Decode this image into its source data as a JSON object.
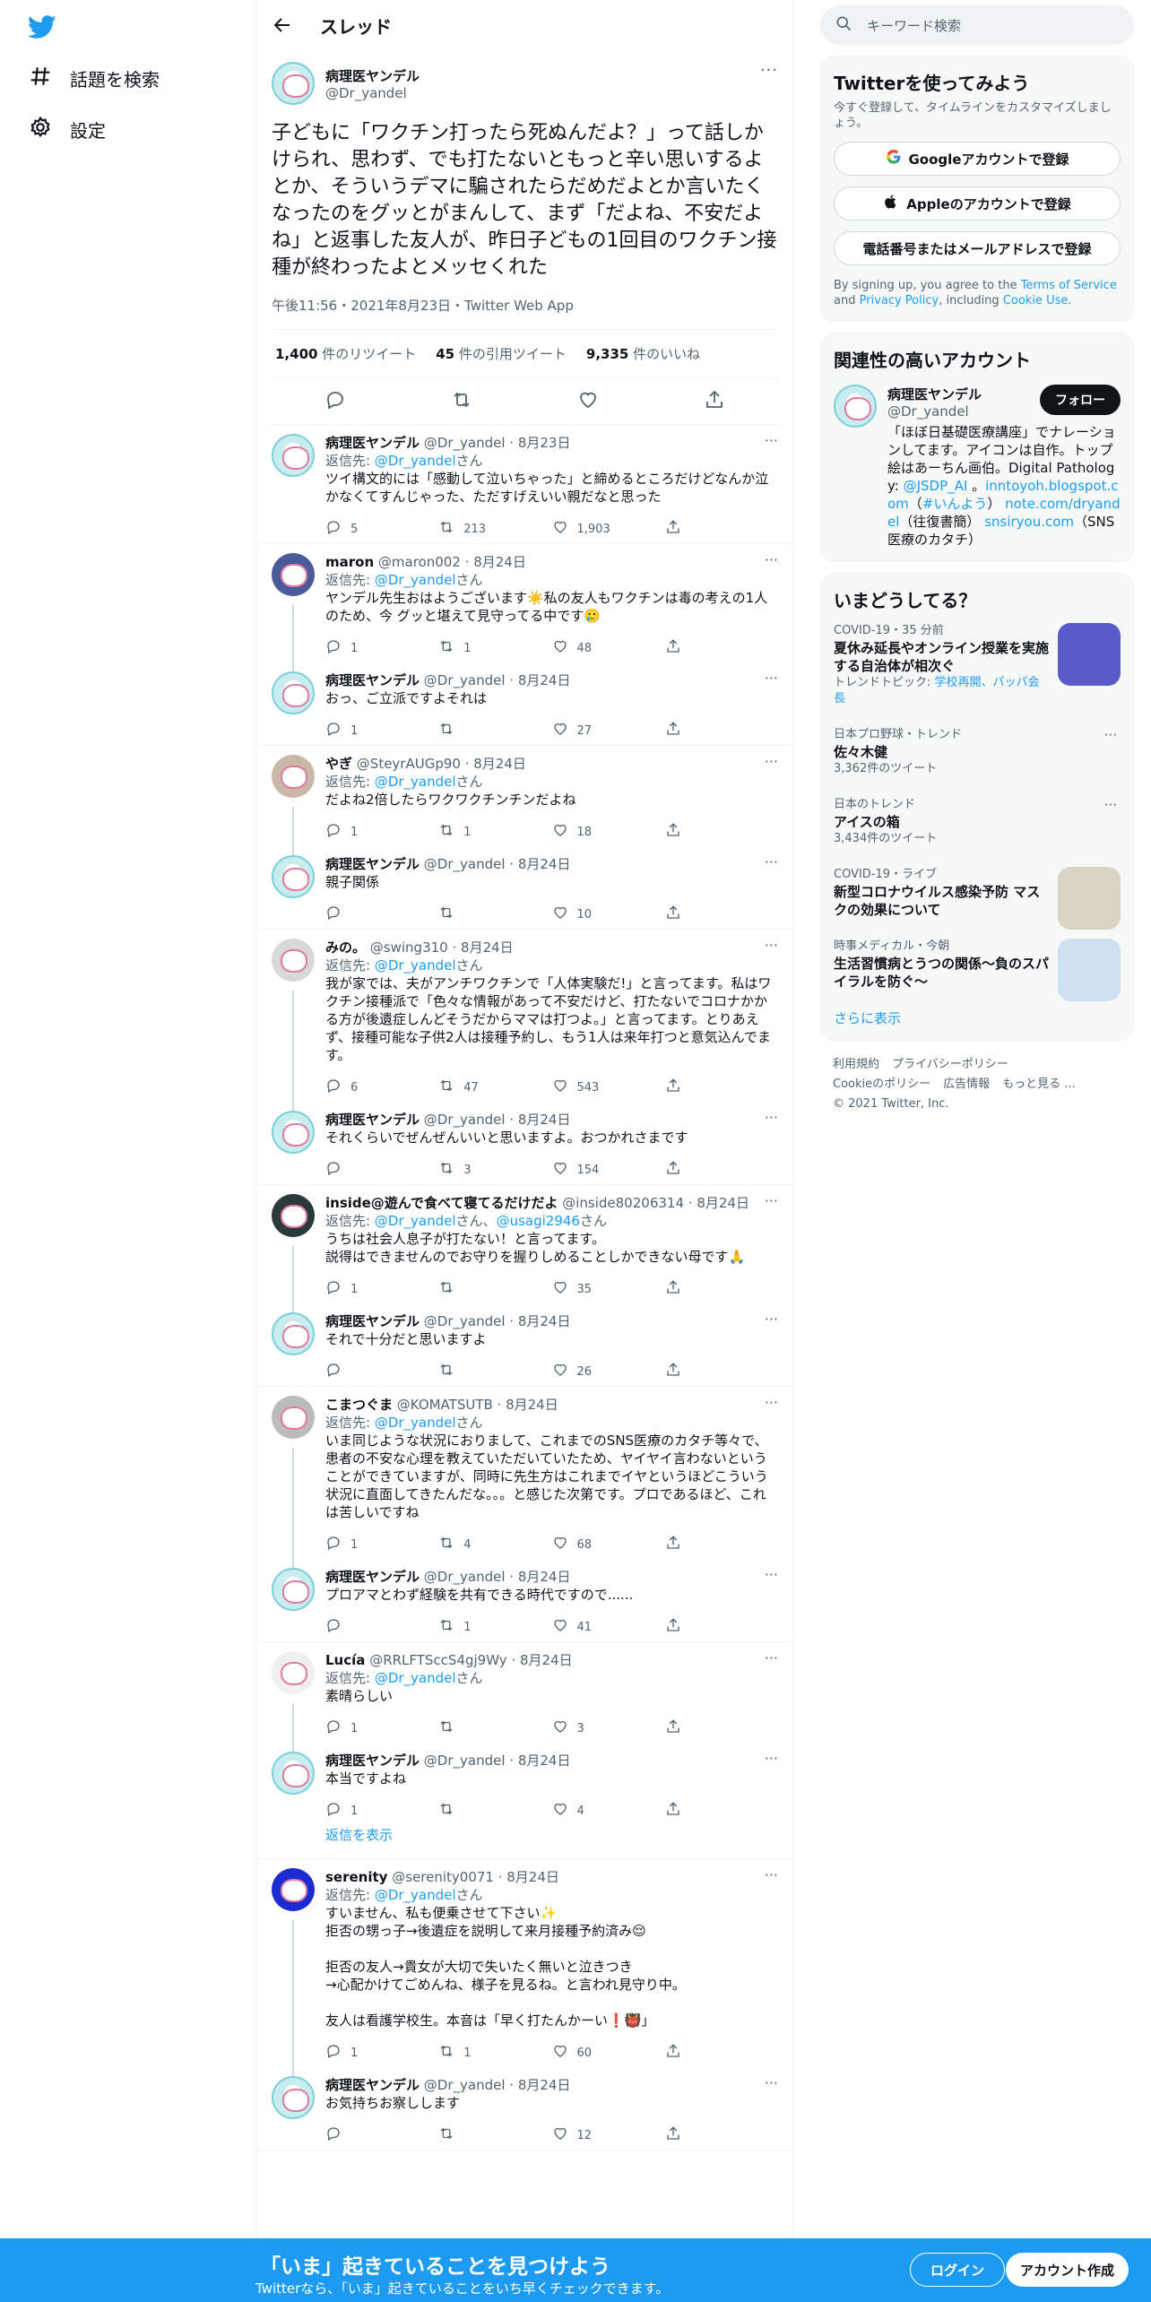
{
  "nav": {
    "explore": "話題を検索",
    "settings": "設定"
  },
  "header": {
    "title": "スレッド"
  },
  "focus": {
    "name": "病理医ヤンデル",
    "handle": "@Dr_yandel",
    "text": "子どもに「ワクチン打ったら死ぬんだよ？」って話しかけられ、思わず、でも打たないともっと辛い思いするよとか、そういうデマに騙されたらだめだよとか言いたくなったのをグッとがまんして、まず「だよね、不安だよね」と返事した友人が、昨日子どもの1回目のワクチン接種が終わったよとメッセくれた",
    "meta": "午後11:56・2021年8月23日・Twitter Web App",
    "retweets_n": "1,400",
    "retweets_l": "件のリツイート",
    "quotes_n": "45",
    "quotes_l": "件の引用ツイート",
    "likes_n": "9,335",
    "likes_l": "件のいいね"
  },
  "reply_prefix": "返信先: ",
  "san": "さん",
  "tweets": [
    {
      "name": "病理医ヤンデル",
      "handle": "@Dr_yandel",
      "date": "8月23日",
      "reply_to": "@Dr_yandel",
      "text": "ツイ構文的には「感動して泣いちゃった」と締めるところだけどなんか泣かなくてすんじゃった、ただすげえいい親だなと思った",
      "replies": "5",
      "rts": "213",
      "likes": "1,903"
    },
    {
      "name": "maron",
      "handle": "@maron002",
      "date": "8月24日",
      "reply_to": "@Dr_yandel",
      "text": "ヤンデル先生おはようございます☀️私の友人もワクチンは毒の考えの1人のため、今 グッと堪えて見守ってる中です🥲",
      "replies": "1",
      "rts": "1",
      "likes": "48"
    },
    {
      "name": "病理医ヤンデル",
      "handle": "@Dr_yandel",
      "date": "8月24日",
      "reply_to": "",
      "text": "おっ、ご立派ですよそれは",
      "replies": "1",
      "rts": "",
      "likes": "27"
    },
    {
      "name": "やぎ",
      "handle": "@SteyrAUGp90",
      "date": "8月24日",
      "reply_to": "@Dr_yandel",
      "text": "だよね2倍したらワクワクチンチンだよね",
      "replies": "1",
      "rts": "1",
      "likes": "18"
    },
    {
      "name": "病理医ヤンデル",
      "handle": "@Dr_yandel",
      "date": "8月24日",
      "reply_to": "",
      "text": "親子関係",
      "replies": "",
      "rts": "",
      "likes": "10"
    },
    {
      "name": "みの。",
      "handle": "@swing310",
      "date": "8月24日",
      "reply_to": "@Dr_yandel",
      "text": "我が家では、夫がアンチワクチンで「人体実験だ!」と言ってます。私はワクチン接種派で「色々な情報があって不安だけど、打たないでコロナかかる方が後遺症しんどそうだからママは打つよ。」と言ってます。とりあえず、接種可能な子供2人は接種予約し、もう1人は来年打つと意気込んでます。",
      "replies": "6",
      "rts": "47",
      "likes": "543"
    },
    {
      "name": "病理医ヤンデル",
      "handle": "@Dr_yandel",
      "date": "8月24日",
      "reply_to": "",
      "text": "それくらいでぜんぜんいいと思いますよ。おつかれさまです",
      "replies": "",
      "rts": "3",
      "likes": "154"
    },
    {
      "name": "inside@遊んで食べて寝てるだけだよ",
      "handle": "@inside80206314",
      "date": "8月24日",
      "reply_to": "@Dr_yandel",
      "reply_to2": "@usagi2946",
      "text": "うちは社会人息子が打たない！と言ってます。\n説得はできませんのでお守りを握りしめることしかできない母です🙏",
      "replies": "1",
      "rts": "",
      "likes": "35"
    },
    {
      "name": "病理医ヤンデル",
      "handle": "@Dr_yandel",
      "date": "8月24日",
      "reply_to": "",
      "text": "それで十分だと思いますよ",
      "replies": "",
      "rts": "",
      "likes": "26"
    },
    {
      "name": "こまつぐま",
      "handle": "@KOMATSUTB",
      "date": "8月24日",
      "reply_to": "@Dr_yandel",
      "text": "いま同じような状況におりまして、これまでのSNS医療のカタチ等々で、患者の不安な心理を教えていただいていたため、ヤイヤイ言わないということができていますが、同時に先生方はこれまでイヤというほどこういう状況に直面してきたんだな。。。と感じた次第です。プロであるほど、これは苦しいですね",
      "replies": "1",
      "rts": "4",
      "likes": "68"
    },
    {
      "name": "病理医ヤンデル",
      "handle": "@Dr_yandel",
      "date": "8月24日",
      "reply_to": "",
      "text": "プロアマとわず経験を共有できる時代ですので......",
      "replies": "",
      "rts": "1",
      "likes": "41"
    },
    {
      "name": "Lucía",
      "handle": "@RRLFTSccS4gj9Wy",
      "date": "8月24日",
      "reply_to": "@Dr_yandel",
      "text": "素晴らしい",
      "replies": "1",
      "rts": "",
      "likes": "3"
    },
    {
      "name": "病理医ヤンデル",
      "handle": "@Dr_yandel",
      "date": "8月24日",
      "reply_to": "",
      "text": "本当ですよね",
      "replies": "1",
      "rts": "",
      "likes": "4"
    },
    {
      "name": "serenity",
      "handle": "@serenity0071",
      "date": "8月24日",
      "reply_to": "@Dr_yandel",
      "text": "すいません、私も便乗させて下さい✨\n拒否の甥っ子→後遺症を説明して来月接種予約済み😌\n\n拒否の友人→貴女が大切で失いたく無いと泣きつき\n→心配かけてごめんね、様子を見るね。と言われ見守り中。\n\n友人は看護学校生。本音は「早く打たんかーい❗️👹」",
      "replies": "1",
      "rts": "1",
      "likes": "60"
    },
    {
      "name": "病理医ヤンデル",
      "handle": "@Dr_yandel",
      "date": "8月24日",
      "reply_to": "",
      "text": "お気持ちお察しします",
      "replies": "",
      "rts": "",
      "likes": "12"
    }
  ],
  "show_replies": "返信を表示",
  "sidebar": {
    "search_placeholder": "キーワード検索",
    "signup": {
      "title": "Twitterを使ってみよう",
      "sub": "今すぐ登録して、タイムラインをカスタマイズしましょう。",
      "google": "Googleアカウントで登録",
      "apple": "Appleのアカウントで登録",
      "phone": "電話番号またはメールアドレスで登録",
      "legal_1": "By signing up, you agree to the ",
      "tos": "Terms of Service",
      "legal_2": " and ",
      "privacy": "Privacy Policy",
      "legal_3": ", including ",
      "cookie": "Cookie Use",
      "legal_4": "."
    },
    "related": {
      "title": "関連性の高いアカウント",
      "name": "病理医ヤンデル",
      "handle": "@Dr_yandel",
      "follow": "フォロー",
      "bio_1": "「ほぼ日基礎医療講座」でナレーションしてます。アイコンは自作。トップ絵はあーちん画伯。Digital Pathology: ",
      "bio_l1": "@JSDP_AI",
      "bio_2": " 。",
      "bio_l2": "inntoyoh.blogspot.com",
      "bio_3": "（",
      "bio_l3": "#いんよう",
      "bio_4": "） ",
      "bio_l4": "note.com/dryandel",
      "bio_5": "（往復書簡） ",
      "bio_l5": "snsiryou.com",
      "bio_6": "（SNS医療のカタチ）"
    },
    "trends": {
      "title": "いまどうしてる？",
      "items": [
        {
          "cat": "COVID-19・35 分前",
          "title": "夏休み延長やオンライン授業を実施する自治体が相次ぐ",
          "extra_1": "トレンドトピック: ",
          "extra_l": "学校再開、パッパ会長",
          "count": "",
          "thumb": true,
          "color": "#5a5ac8"
        },
        {
          "cat": "日本プロ野球・トレンド",
          "title": "佐々木健",
          "count": "3,362件のツイート",
          "thumb": false
        },
        {
          "cat": "日本のトレンド",
          "title": "アイスの箱",
          "count": "3,434件のツイート",
          "thumb": false
        },
        {
          "cat": "COVID-19・ライブ",
          "title": "新型コロナウイルス感染予防 マスクの効果について",
          "count": "",
          "thumb": true,
          "color": "#d9d4c4"
        },
        {
          "cat": "時事メディカル・今朝",
          "title": "生活習慣病とうつの関係～負のスパイラルを防ぐ～",
          "count": "",
          "thumb": true,
          "color": "#cfe0f0"
        }
      ],
      "more": "さらに表示"
    },
    "footer": [
      "利用規約",
      "プライバシーポリシー",
      "Cookieのポリシー",
      "広告情報",
      "もっと見る ...",
      "© 2021 Twitter, Inc."
    ]
  },
  "bottom": {
    "title": "「いま」起きていることを見つけよう",
    "sub": "Twitterなら、「いま」起きていることをいち早くチェックできます。",
    "login": "ログイン",
    "signup": "アカウント作成"
  }
}
